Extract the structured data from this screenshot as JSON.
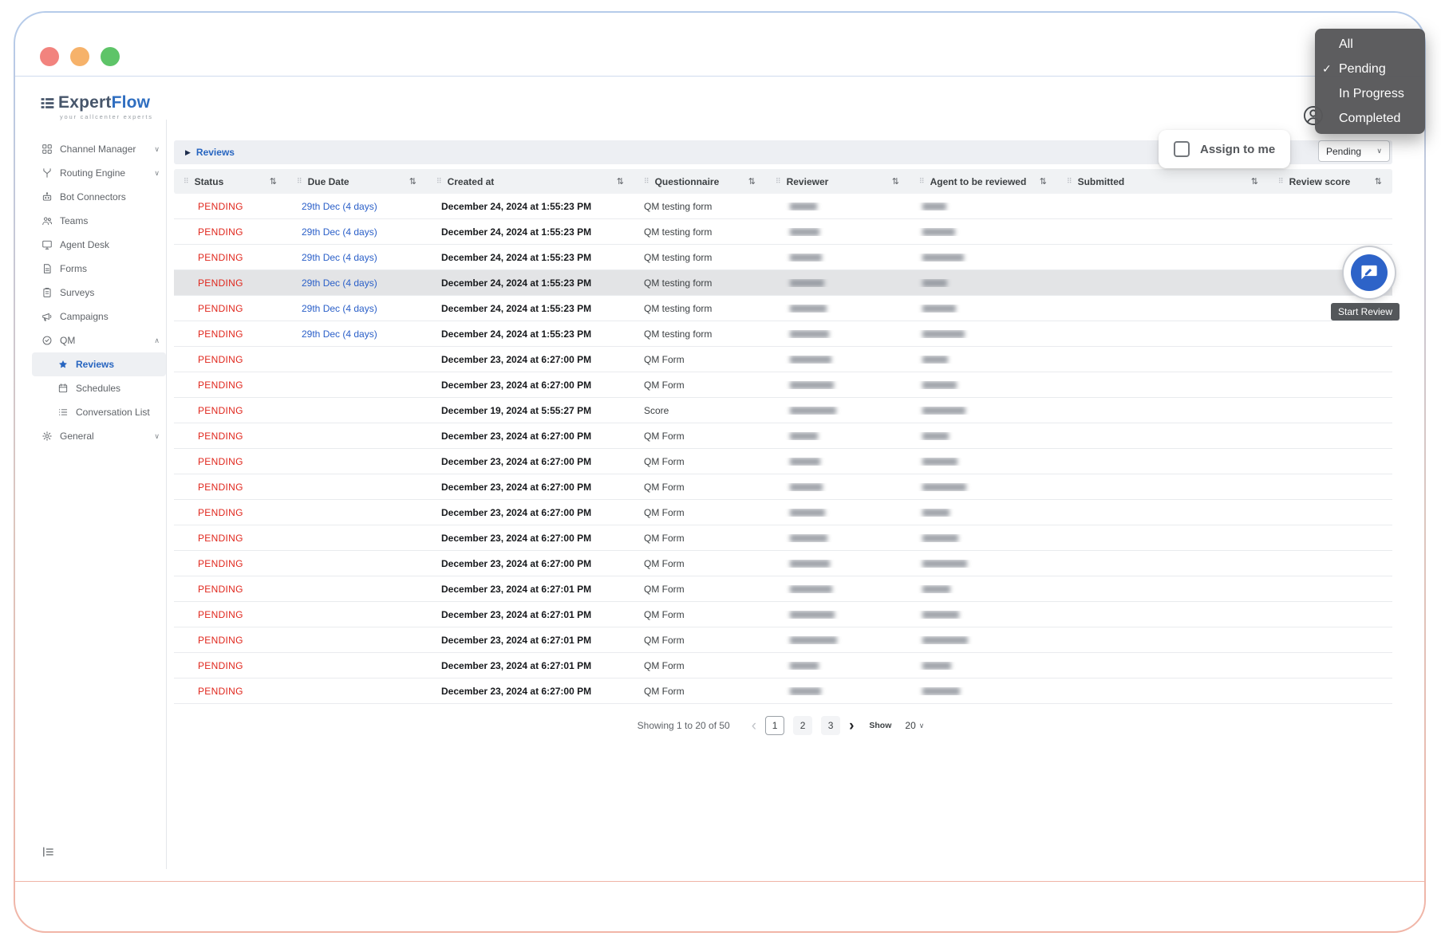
{
  "brand": {
    "name_a": "Expert",
    "name_b": "Flow",
    "tagline": "your callcenter experts"
  },
  "filter_menu": {
    "items": [
      {
        "label": "All"
      },
      {
        "label": "Pending",
        "checked": true
      },
      {
        "label": "In Progress"
      },
      {
        "label": "Completed"
      }
    ]
  },
  "sidebar": {
    "items": [
      {
        "label": "Channel Manager",
        "icon": "channel-manager",
        "chevron": "down"
      },
      {
        "label": "Routing Engine",
        "icon": "routing-engine",
        "chevron": "down"
      },
      {
        "label": "Bot Connectors",
        "icon": "bot-connectors"
      },
      {
        "label": "Teams",
        "icon": "teams"
      },
      {
        "label": "Agent Desk",
        "icon": "agent-desk"
      },
      {
        "label": "Forms",
        "icon": "forms"
      },
      {
        "label": "Surveys",
        "icon": "surveys"
      },
      {
        "label": "Campaigns",
        "icon": "campaigns"
      },
      {
        "label": "QM",
        "icon": "qm",
        "chevron": "up"
      },
      {
        "label": "Reviews",
        "icon": "reviews",
        "sub": true,
        "active": true
      },
      {
        "label": "Schedules",
        "icon": "schedules",
        "sub": true
      },
      {
        "label": "Conversation List",
        "icon": "conversation-list",
        "sub": true
      },
      {
        "label": "General",
        "icon": "general",
        "chevron": "down"
      }
    ]
  },
  "toolbar": {
    "breadcrumb": "Reviews",
    "assign_label": "Assign to me",
    "status_filter": "Pending"
  },
  "table": {
    "columns": [
      "Status",
      "Due Date",
      "Created at",
      "Questionnaire",
      "Reviewer",
      "Agent to be reviewed",
      "Submitted",
      "Review score"
    ],
    "rows": [
      {
        "status": "PENDING",
        "due_date": "29th Dec (4 days)",
        "created_at": "December 24, 2024 at 1:55:23 PM",
        "questionnaire": "QM testing form",
        "reviewer_redacted": true,
        "agent_redacted": true
      },
      {
        "status": "PENDING",
        "due_date": "29th Dec (4 days)",
        "created_at": "December 24, 2024 at 1:55:23 PM",
        "questionnaire": "QM testing form",
        "reviewer_redacted": true,
        "agent_redacted": true
      },
      {
        "status": "PENDING",
        "due_date": "29th Dec (4 days)",
        "created_at": "December 24, 2024 at 1:55:23 PM",
        "questionnaire": "QM testing form",
        "reviewer_redacted": true,
        "agent_redacted": true
      },
      {
        "status": "PENDING",
        "due_date": "29th Dec (4 days)",
        "created_at": "December 24, 2024 at 1:55:23 PM",
        "questionnaire": "QM testing form",
        "reviewer_redacted": true,
        "agent_redacted": true,
        "highlighted": true
      },
      {
        "status": "PENDING",
        "due_date": "29th Dec (4 days)",
        "created_at": "December 24, 2024 at 1:55:23 PM",
        "questionnaire": "QM testing form",
        "reviewer_redacted": true,
        "agent_redacted": true
      },
      {
        "status": "PENDING",
        "due_date": "29th Dec (4 days)",
        "created_at": "December 24, 2024 at 1:55:23 PM",
        "questionnaire": "QM testing form",
        "reviewer_redacted": true,
        "agent_redacted": true
      },
      {
        "status": "PENDING",
        "due_date": "",
        "created_at": "December 23, 2024 at 6:27:00 PM",
        "questionnaire": "QM Form",
        "reviewer_redacted": true,
        "agent_redacted": true
      },
      {
        "status": "PENDING",
        "due_date": "",
        "created_at": "December 23, 2024 at 6:27:00 PM",
        "questionnaire": "QM Form",
        "reviewer_redacted": true,
        "agent_redacted": true
      },
      {
        "status": "PENDING",
        "due_date": "",
        "created_at": "December 19, 2024 at 5:55:27 PM",
        "questionnaire": "Score",
        "reviewer_redacted": true,
        "agent_redacted": true
      },
      {
        "status": "PENDING",
        "due_date": "",
        "created_at": "December 23, 2024 at 6:27:00 PM",
        "questionnaire": "QM Form",
        "reviewer_redacted": true,
        "agent_redacted": true
      },
      {
        "status": "PENDING",
        "due_date": "",
        "created_at": "December 23, 2024 at 6:27:00 PM",
        "questionnaire": "QM Form",
        "reviewer_redacted": true,
        "agent_redacted": true
      },
      {
        "status": "PENDING",
        "due_date": "",
        "created_at": "December 23, 2024 at 6:27:00 PM",
        "questionnaire": "QM Form",
        "reviewer_redacted": true,
        "agent_redacted": true
      },
      {
        "status": "PENDING",
        "due_date": "",
        "created_at": "December 23, 2024 at 6:27:00 PM",
        "questionnaire": "QM Form",
        "reviewer_redacted": true,
        "agent_redacted": true
      },
      {
        "status": "PENDING",
        "due_date": "",
        "created_at": "December 23, 2024 at 6:27:00 PM",
        "questionnaire": "QM Form",
        "reviewer_redacted": true,
        "agent_redacted": true
      },
      {
        "status": "PENDING",
        "due_date": "",
        "created_at": "December 23, 2024 at 6:27:00 PM",
        "questionnaire": "QM Form",
        "reviewer_redacted": true,
        "agent_redacted": true
      },
      {
        "status": "PENDING",
        "due_date": "",
        "created_at": "December 23, 2024 at 6:27:01 PM",
        "questionnaire": "QM Form",
        "reviewer_redacted": true,
        "agent_redacted": true
      },
      {
        "status": "PENDING",
        "due_date": "",
        "created_at": "December 23, 2024 at 6:27:01 PM",
        "questionnaire": "QM Form",
        "reviewer_redacted": true,
        "agent_redacted": true
      },
      {
        "status": "PENDING",
        "due_date": "",
        "created_at": "December 23, 2024 at 6:27:01 PM",
        "questionnaire": "QM Form",
        "reviewer_redacted": true,
        "agent_redacted": true
      },
      {
        "status": "PENDING",
        "due_date": "",
        "created_at": "December 23, 2024 at 6:27:01 PM",
        "questionnaire": "QM Form",
        "reviewer_redacted": true,
        "agent_redacted": true
      },
      {
        "status": "PENDING",
        "due_date": "",
        "created_at": "December 23, 2024 at 6:27:00 PM",
        "questionnaire": "QM Form",
        "reviewer_redacted": true,
        "agent_redacted": true
      }
    ]
  },
  "floating_action": {
    "tooltip": "Start Review"
  },
  "pagination": {
    "summary": "Showing 1 to 20 of 50",
    "pages": [
      "1",
      "2",
      "3"
    ],
    "active_page": "1",
    "show_label": "Show",
    "page_size": "20"
  },
  "colors": {
    "accent_blue": "#2d63c8",
    "pending_red": "#e0261c",
    "link_blue": "#2a5fc8"
  }
}
